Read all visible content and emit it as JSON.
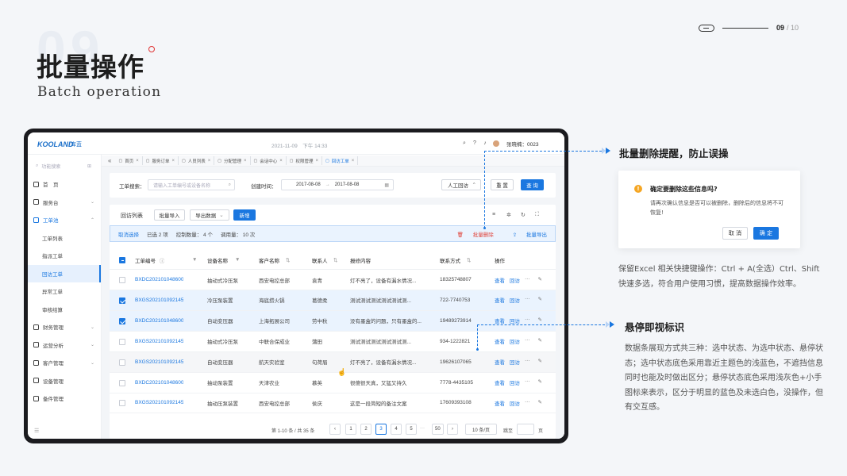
{
  "header": {
    "title": "批量操作",
    "subtitle": "Batch operation",
    "page_current": "09",
    "page_total": "/ 10"
  },
  "app": {
    "logo": "KOOLAND",
    "logo_cn": "库蓝",
    "datetime": "2021-11-09　下午 14:33",
    "user": "张晓楠：0023",
    "sidebar": {
      "search_placeholder": "功能搜索",
      "items": [
        {
          "label": "首　页",
          "type": "top",
          "icon": "home-icon"
        },
        {
          "label": "服务台",
          "type": "top",
          "icon": "service-icon",
          "chevron": "⌄"
        },
        {
          "label": "工单池",
          "type": "group",
          "icon": "ticket-icon",
          "chevron": "⌃"
        },
        {
          "label": "工单列表",
          "type": "sub"
        },
        {
          "label": "指派工单",
          "type": "sub"
        },
        {
          "label": "回访工单",
          "type": "sub",
          "active": true
        },
        {
          "label": "异常工单",
          "type": "sub"
        },
        {
          "label": "审核结算",
          "type": "sub"
        },
        {
          "label": "财务管理",
          "type": "top",
          "icon": "finance-icon",
          "chevron": "⌄"
        },
        {
          "label": "运营分析",
          "type": "top",
          "icon": "analytics-icon",
          "chevron": "⌄"
        },
        {
          "label": "客户管理",
          "type": "top",
          "icon": "customer-icon",
          "chevron": "⌄"
        },
        {
          "label": "设备管理",
          "type": "top",
          "icon": "device-icon"
        },
        {
          "label": "备件管理",
          "type": "top",
          "icon": "parts-icon"
        }
      ]
    },
    "tabs": [
      {
        "label": "首页"
      },
      {
        "label": "服务订单"
      },
      {
        "label": "人员列表"
      },
      {
        "label": "分配管理"
      },
      {
        "label": "会话中心"
      },
      {
        "label": "权限管理"
      },
      {
        "label": "回访工单",
        "active": true
      }
    ],
    "search": {
      "ticket_label": "工单搜索：",
      "ticket_placeholder": "请输入工单编号或设备名称",
      "created_label": "创建时间：",
      "date_from": "2017-08-08",
      "date_sep": "→",
      "date_to": "2017-08-08",
      "type_select": "人工回访",
      "reset_label": "重 置",
      "query_label": "查 询"
    },
    "list": {
      "title": "回访列表",
      "import_label": "批量导入",
      "export_label": "导出数据",
      "add_label": "新增",
      "selbar": {
        "cancel": "取消选择",
        "selected": "已选 2 项",
        "control": "控制数量：  4 个",
        "usage": "调用量：  10 次",
        "batch_delete": "批量删除",
        "batch_export": "批量导出"
      },
      "columns": [
        "工单编号",
        "设备名称",
        "客户名称",
        "联系人",
        "报修内容",
        "联系方式",
        "操作"
      ],
      "rows": [
        {
          "id": "BXDC202101048600",
          "device": "抽动式冷压泵",
          "customer": "西安电控总部",
          "contact": "袁青",
          "content": "灯不亮了，设备有漏水情况...",
          "phone": "18325748807",
          "state": "normal"
        },
        {
          "id": "BXGS202101092145",
          "device": "冷压泵装置",
          "customer": "海底捞火锅",
          "contact": "葛德柔",
          "content": "测试测试测试测试测试测...",
          "phone": "722-7740753",
          "state": "selected"
        },
        {
          "id": "BXDC202101048600",
          "device": "自动变压器",
          "customer": "上海拓展公司",
          "contact": "劳中秋",
          "content": "没有墨盒的问题，只有墨盒的...",
          "phone": "19489273914",
          "state": "selected"
        },
        {
          "id": "BXGS202101092145",
          "device": "抽动式冷压泵",
          "customer": "中联合保成业",
          "contact": "蒲田",
          "content": "测试测试测试测试测试测...",
          "phone": "934-1222821",
          "state": "normal"
        },
        {
          "id": "BXGS202101092145",
          "device": "自动变压器",
          "customer": "航天实验室",
          "contact": "句荷眉",
          "content": "灯不亮了，设备有漏水情况...",
          "phone": "19626107065",
          "state": "hover"
        },
        {
          "id": "BXDC202101048600",
          "device": "抽动泵装置",
          "customer": "天津农业",
          "contact": "慕英",
          "content": "很傻很天真，又猛又持久",
          "phone": "7778-4435105",
          "state": "normal"
        },
        {
          "id": "BXGS202101092145",
          "device": "抽动压泵装置",
          "customer": "西安电控总部",
          "contact": "侯庆",
          "content": "这是一段简短的备注文案",
          "phone": "17609393108",
          "state": "normal"
        }
      ],
      "op_view": "查看",
      "op_visit": "回访",
      "op_more": "···",
      "op_edit": "✎",
      "pagination": {
        "summary": "第 1-10 条 / 共 35 条",
        "prev": "‹",
        "pages": [
          "1",
          "2",
          "3",
          "4",
          "5"
        ],
        "current": "3",
        "ellipsis": "···",
        "last": "50",
        "next": "›",
        "size": "10 条/页",
        "goto_label": "跳至",
        "page_unit": "页"
      }
    }
  },
  "annotations": {
    "delete_title": "批量删除提醒，防止误操",
    "dialog": {
      "title": "确定要删除这些信息吗?",
      "message": "请再次确认信息是否可以被删除，删除后的信息将不可恢复!",
      "cancel": "取 消",
      "confirm": "确 定"
    },
    "delete_desc": "保留Excel 相关快捷键操作：Ctrl + A(全选）Ctrl、Shift快速多选，符合用户使用习惯，提高数据操作效率。",
    "hover_title": "悬停即视标识",
    "hover_desc": "数据条展现方式共三种：选中状态、为选中状态、悬停状态；选中状态底色采用靠近主题色的浅蓝色，不遮挡信息同时也能及时做出区分；悬停状态底色采用浅灰色+小手图标来表示，区分于明显的蓝色及未选白色，没操作，但有交互感。"
  },
  "colors": {
    "primary": "#1a77e0",
    "selected_row": "#eaf3fe",
    "hover_row": "#f5f6f8",
    "danger": "#e0453c",
    "warning": "#f5a623"
  }
}
